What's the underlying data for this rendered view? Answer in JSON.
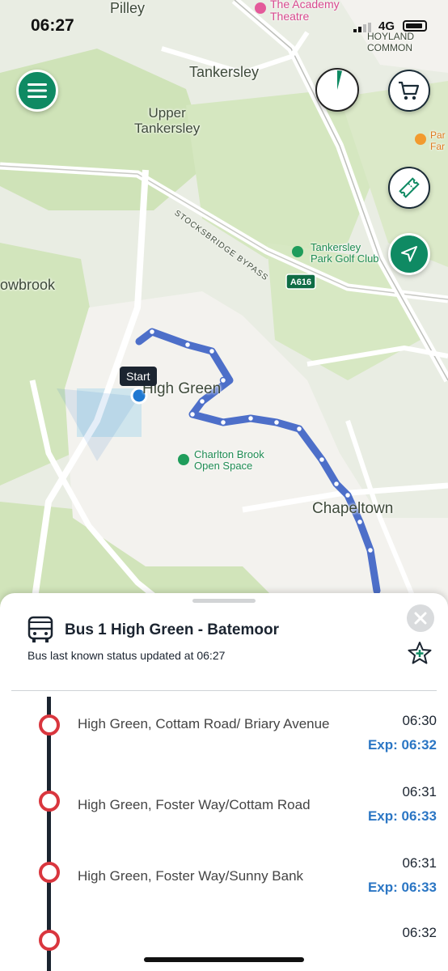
{
  "status_bar": {
    "time": "06:27",
    "network": "4G"
  },
  "map": {
    "labels": {
      "pilley": "Pilley",
      "theatre": "The Academy\nTheatre",
      "hoyland": "HOYLAND\nCOMMON",
      "tankersley": "Tankersley",
      "upper": "Upper\nTankersley",
      "bypass": "STOCKSBRIDGE BYPASS",
      "golf": "Tankersley\nPark Golf Club",
      "road": "A616",
      "owbrook": "owbrook",
      "highgreen": "High Green",
      "charlton": "Charlton Brook\nOpen Space",
      "chapeltown": "Chapeltown",
      "park": "Par\nFar"
    },
    "start_label": "Start"
  },
  "buttons": {
    "menu": "menu",
    "basket": "basket",
    "tickets": "tickets",
    "locate": "locate"
  },
  "route": {
    "title": "Bus 1 High Green - Batemoor",
    "status": "Bus last known status updated at 06:27"
  },
  "stops": [
    {
      "name": "High Green, Cottam Road/ Briary Avenue",
      "scheduled": "06:30",
      "expected": "Exp: 06:32"
    },
    {
      "name": "High Green, Foster Way/Cottam Road",
      "scheduled": "06:31",
      "expected": "Exp: 06:33"
    },
    {
      "name": "High Green, Foster Way/Sunny Bank",
      "scheduled": "06:31",
      "expected": "Exp: 06:33"
    },
    {
      "name": "",
      "scheduled": "06:32",
      "expected": ""
    }
  ],
  "colors": {
    "accent": "#0f8a63",
    "route_line": "#4d6fc9",
    "stop_ring": "#d9363e",
    "expected": "#2b76c4"
  }
}
